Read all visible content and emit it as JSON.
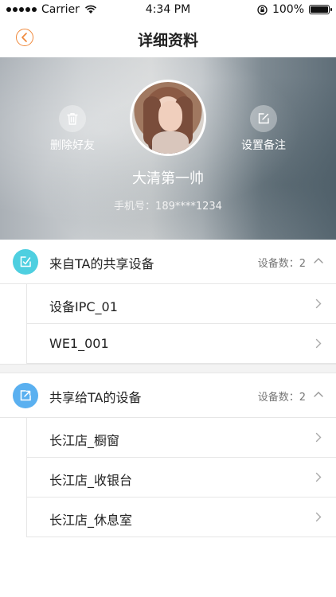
{
  "status_bar": {
    "carrier": "Carrier",
    "time": "4:34 PM",
    "battery": "100%",
    "battery_level": 1.0
  },
  "nav": {
    "title": "详细资料",
    "back_icon": "chevron-left-icon"
  },
  "profile": {
    "name": "大清第一帅",
    "phone": "手机号：189****1234",
    "delete_label": "删除好友",
    "remark_label": "设置备注"
  },
  "sections": [
    {
      "title": "来自TA的共享设备",
      "count": "设备数：2",
      "icon_color": "#4ecfe0",
      "items": [
        "设备IPC_01",
        "WE1_001"
      ]
    },
    {
      "title": "共享给TA的设备",
      "count": "设备数：2",
      "icon_color": "#5ab0f0",
      "items": [
        "长江店_橱窗",
        "长江店_收银台",
        "长江店_休息室"
      ]
    }
  ],
  "colors": {
    "accent": "#f0883a",
    "divider": "#e6e6e6"
  }
}
